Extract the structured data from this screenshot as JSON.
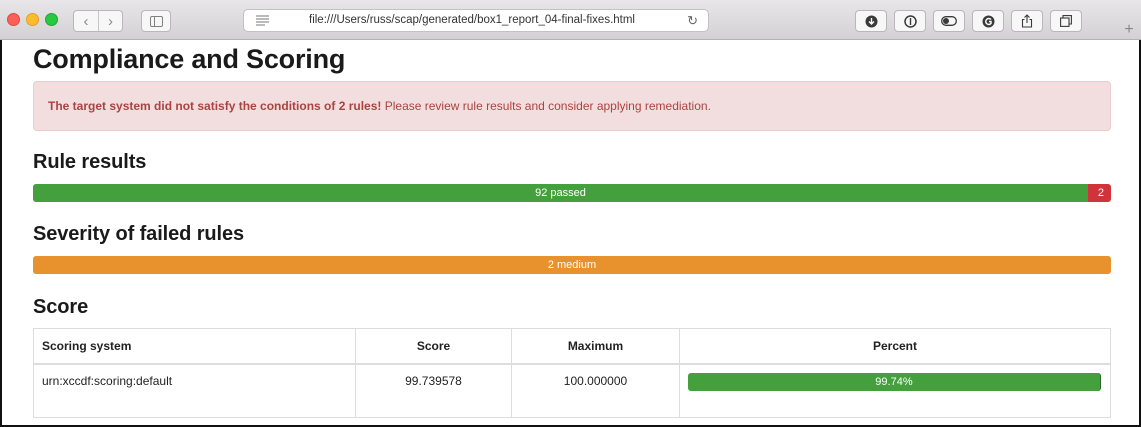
{
  "browser": {
    "url": "file:///Users/russ/scap/generated/box1_report_04-final-fixes.html",
    "back_glyph": "‹",
    "forward_glyph": "›",
    "reload_glyph": "↻",
    "newtab_glyph": "+",
    "toolbar_icons": [
      "download-icon",
      "info-icon",
      "toggle-icon",
      "extension-icon",
      "share-icon",
      "tabs-icon"
    ]
  },
  "page": {
    "title": "Compliance and Scoring",
    "alert": {
      "strong": "The target system did not satisfy the conditions of 2 rules!",
      "text": " Please review rule results and consider applying remediation."
    },
    "rule_results": {
      "heading": "Rule results",
      "passed_label": "92 passed",
      "failed_label": "2",
      "passed": 92,
      "failed": 2,
      "colors": {
        "passed": "#43a03d",
        "failed": "#d0343a"
      }
    },
    "severity": {
      "heading": "Severity of failed rules",
      "medium_label": "2 medium",
      "medium": 2,
      "color": "#e8922d"
    },
    "score": {
      "heading": "Score",
      "columns": [
        "Scoring system",
        "Score",
        "Maximum",
        "Percent"
      ],
      "rows": [
        {
          "system": "urn:xccdf:scoring:default",
          "score": "99.739578",
          "maximum": "100.000000",
          "percent": "99.74%",
          "percent_value": 99.74
        }
      ]
    }
  }
}
